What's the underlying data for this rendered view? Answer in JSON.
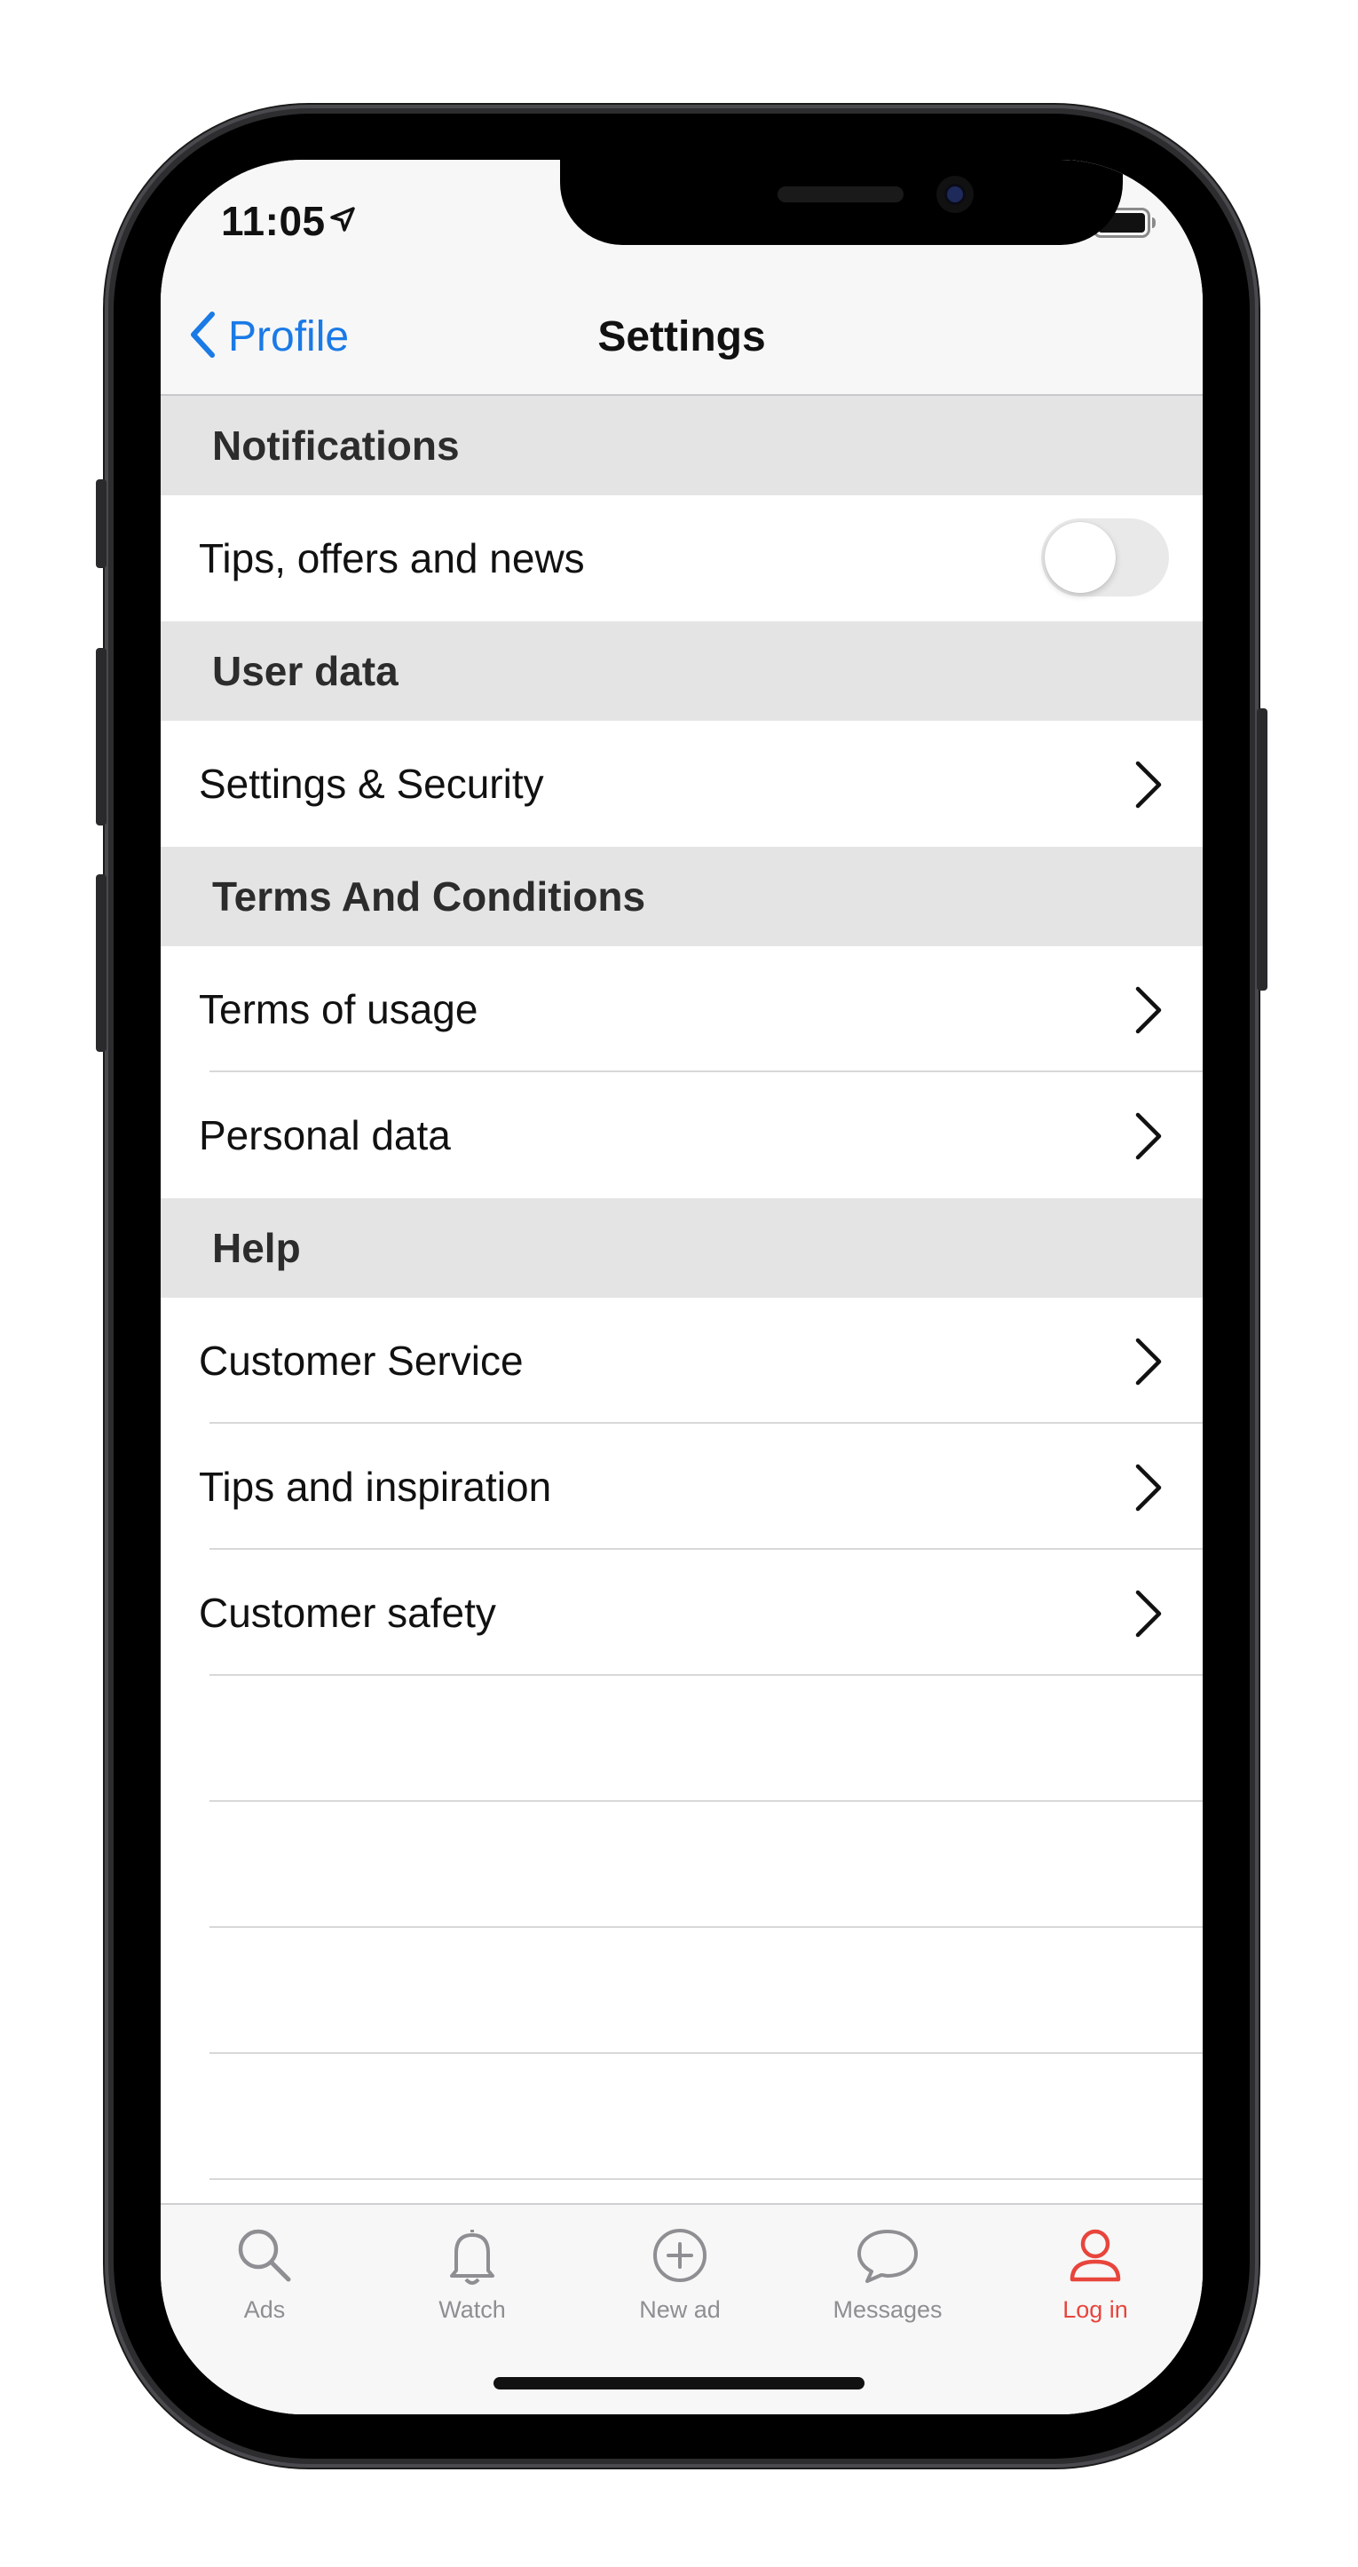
{
  "status_bar": {
    "time": "11:05"
  },
  "nav": {
    "back_label": "Profile",
    "title": "Settings"
  },
  "sections": {
    "notifications": {
      "title": "Notifications",
      "tips_label": "Tips, offers and news",
      "tips_enabled": false
    },
    "user_data": {
      "title": "User data",
      "security_label": "Settings & Security"
    },
    "terms": {
      "title": "Terms And Conditions",
      "usage_label": "Terms of usage",
      "personal_label": "Personal data"
    },
    "help": {
      "title": "Help",
      "customer_service_label": "Customer Service",
      "tips_inspiration_label": "Tips and inspiration",
      "customer_safety_label": "Customer safety"
    }
  },
  "tabs": {
    "ads": "Ads",
    "watch": "Watch",
    "new_ad": "New ad",
    "messages": "Messages",
    "login": "Log in"
  },
  "colors": {
    "accent_blue": "#1a7ae6",
    "active_tab_red": "#e8453c",
    "inactive_tab_gray": "#8e8e93"
  }
}
